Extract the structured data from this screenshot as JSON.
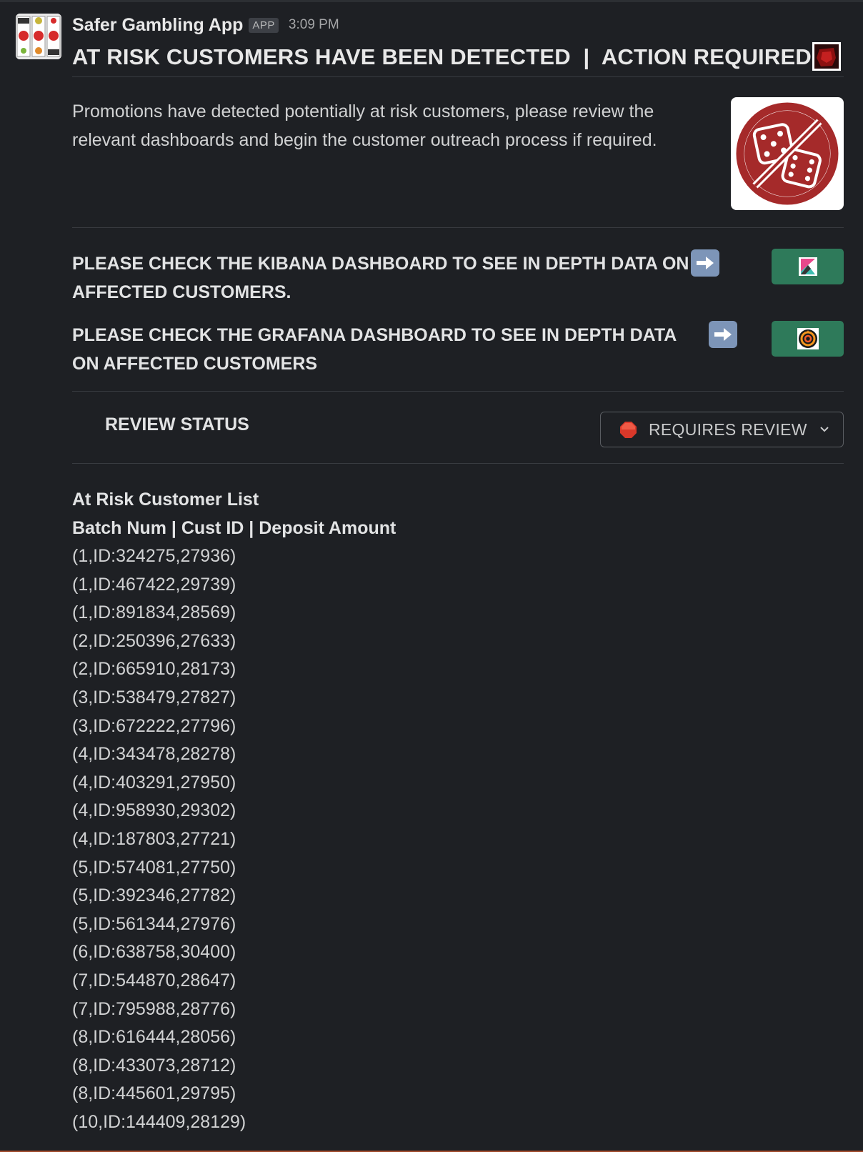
{
  "message": {
    "sender": "Safer Gambling App",
    "badge": "APP",
    "time": "3:09 PM",
    "header": "AT RISK CUSTOMERS HAVE BEEN DETECTED  |  ACTION REQUIRED",
    "body": "Promotions have detected potentially at risk customers, please review the relevant dashboards and begin the customer outreach process if required.",
    "image_icon": "no-gambling-dice-icon"
  },
  "links": [
    {
      "text": "PLEASE CHECK THE KIBANA DASHBOARD TO SEE IN DEPTH DATA ON AFFECTED CUSTOMERS.",
      "button_icon": "kibana-logo-icon"
    },
    {
      "text": "PLEASE CHECK THE GRAFANA DASHBOARD TO SEE IN DEPTH DATA ON AFFECTED CUSTOMERS",
      "button_icon": "grafana-logo-icon"
    }
  ],
  "review": {
    "label": "REVIEW STATUS",
    "selected": "REQUIRES REVIEW"
  },
  "customer_list": {
    "title": "At Risk Customer List",
    "columns": "Batch Num | Cust ID | Deposit Amount",
    "rows": [
      "(1,ID:324275,27936)",
      "(1,ID:467422,29739)",
      "(1,ID:891834,28569)",
      "(2,ID:250396,27633)",
      "(2,ID:665910,28173)",
      "(3,ID:538479,27827)",
      "(3,ID:672222,27796)",
      "(4,ID:343478,28278)",
      "(4,ID:403291,27950)",
      "(4,ID:958930,29302)",
      "(4,ID:187803,27721)",
      "(5,ID:574081,27750)",
      "(5,ID:392346,27782)",
      "(5,ID:561344,27976)",
      "(6,ID:638758,30400)",
      "(7,ID:544870,28647)",
      "(7,ID:795988,28776)",
      "(8,ID:616444,28056)",
      "(8,ID:433073,28712)",
      "(8,ID:445601,29795)",
      "(10,ID:144409,28129)"
    ]
  },
  "colors": {
    "background": "#1e2024",
    "text": "#d1d2d3",
    "button_green": "#2e7a5a",
    "divider": "#383b40",
    "dice_red": "#a52a2a",
    "status_red": "#d9382a"
  }
}
